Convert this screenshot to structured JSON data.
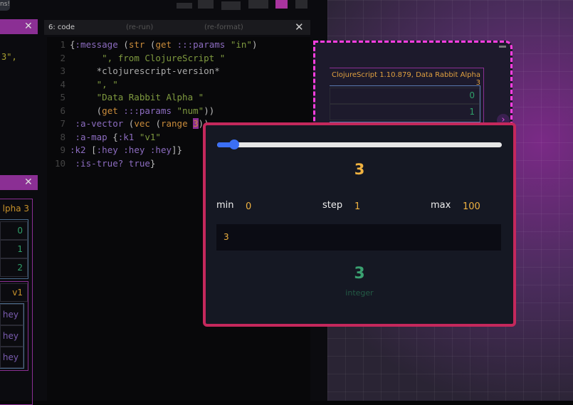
{
  "top_badge": "ns!",
  "left_panel": {
    "snippet": "3\",",
    "close": "✕",
    "result_title": "lpha 3",
    "numbers": [
      "0",
      "1",
      "2"
    ],
    "map_value": "v1",
    "hey_items": [
      "hey",
      "hey",
      "hey"
    ]
  },
  "code_panel": {
    "title": "6: code",
    "rerun": "(re-run)",
    "reformat": "(re-format)",
    "close": "✕",
    "lines": [
      "1",
      "2",
      "3",
      "4",
      "5",
      "6",
      "7",
      "8",
      "9",
      "10"
    ]
  },
  "block": {
    "result_text": "ClojureScript 1.10.879, Data Rabbit Alpha 3",
    "numbers": [
      "0",
      "1"
    ],
    "minimize": "—",
    "expand": "›"
  },
  "slider_popup": {
    "value": 3,
    "min": 0,
    "max": 100,
    "step": 1,
    "value_display": "3",
    "min_label": "min",
    "min_value": "0",
    "step_label": "step",
    "step_value": "1",
    "max_label": "max",
    "max_value": "100",
    "input_value": "3",
    "result_value": "3",
    "result_type": "integer",
    "accent": "#3b6ff5",
    "border": "#c4285c"
  }
}
